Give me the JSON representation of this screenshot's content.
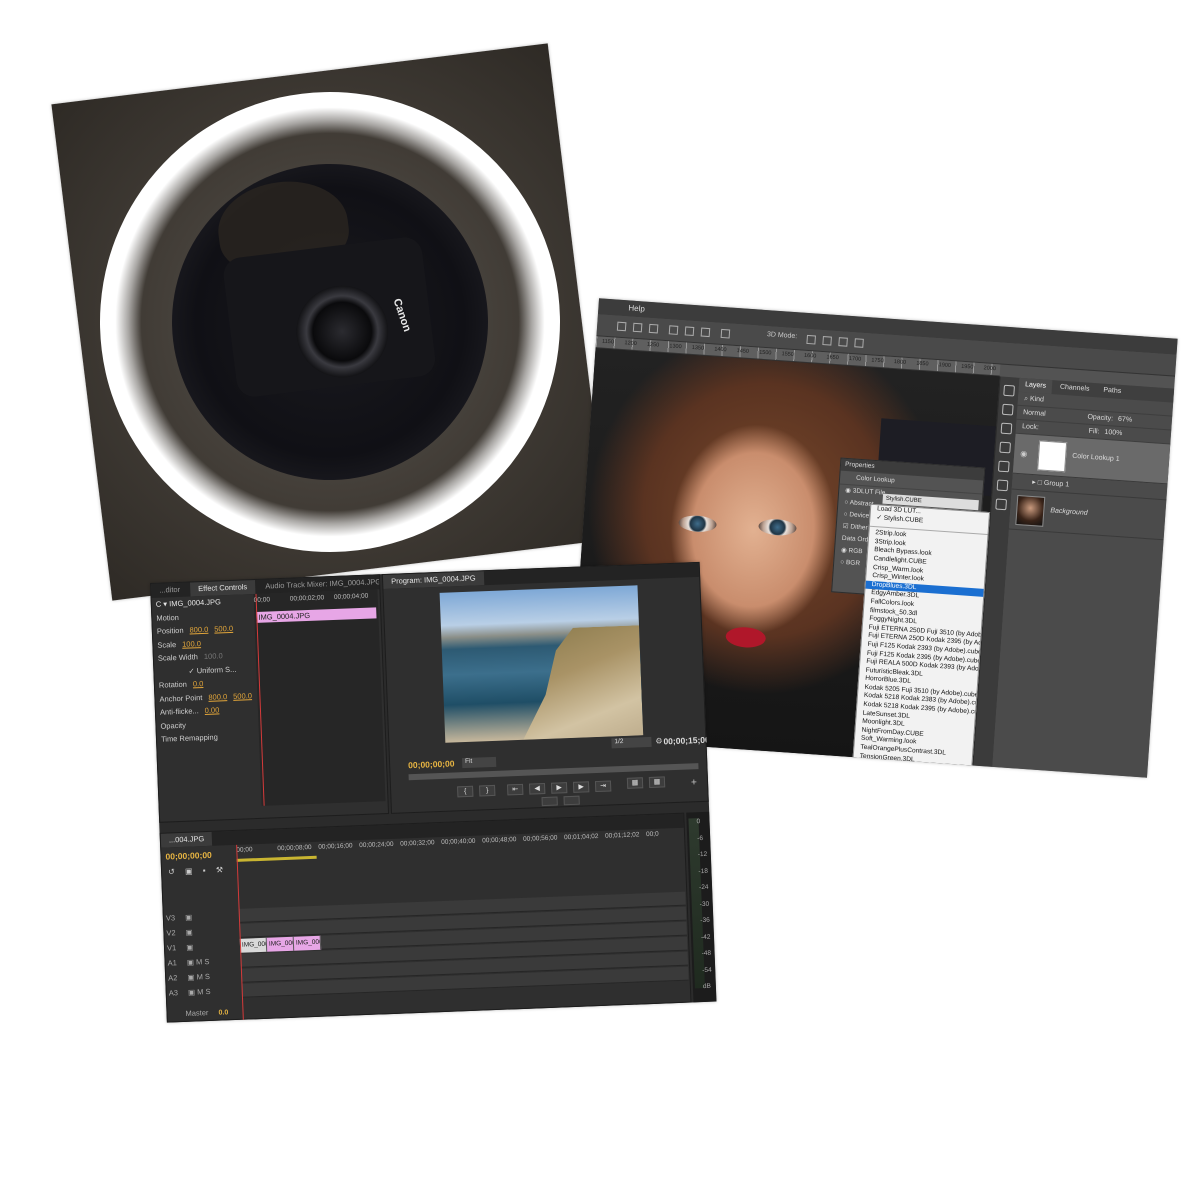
{
  "ring_photo": {
    "camera_brand": "Canon"
  },
  "photoshop": {
    "menu": "Help",
    "ruler_ticks": [
      "1150",
      "1200",
      "1250",
      "1300",
      "1350",
      "1400",
      "1450",
      "1500",
      "1550",
      "1600",
      "1650",
      "1700",
      "1750",
      "1800",
      "1850",
      "1900",
      "1950",
      "2000"
    ],
    "toolbar_zoom_label": "3D Mode:",
    "layers_panel": {
      "tabs": [
        "Layers",
        "Channels",
        "Paths"
      ],
      "kind": "Kind",
      "blend_mode": "Normal",
      "opacity_label": "Opacity:",
      "opacity_value": "67%",
      "lock_label": "Lock:",
      "fill_label": "Fill:",
      "fill_value": "100%",
      "layers": [
        {
          "name": "Color Lookup 1",
          "type": "adjustment"
        },
        {
          "name": "Group 1",
          "type": "group"
        },
        {
          "name": "Background",
          "type": "photo"
        }
      ]
    },
    "properties_panel": {
      "title": "Properties",
      "subtitle": "Color Lookup",
      "options": [
        "3DLUT File",
        "Abstract",
        "Device Link",
        "Dither",
        "Data Order",
        "RGB",
        "BGR"
      ],
      "selected_lut": "Stylish.CUBE"
    },
    "lut_menu": {
      "header": [
        "Load 3D LUT...",
        "Stylish.CUBE"
      ],
      "checked": "Stylish.CUBE",
      "items": [
        "2Strip.look",
        "3Strip.look",
        "Bleach Bypass.look",
        "Candlelight.CUBE",
        "Crisp_Warm.look",
        "Crisp_Winter.look",
        "DropBlues.3DL",
        "EdgyAmber.3DL",
        "FallColors.look",
        "filmstock_50.3dl",
        "FoggyNight.3DL",
        "Fuji ETERNA 250D Fuji 3510 (by Adobe).cube",
        "Fuji ETERNA 250D Kodak 2395 (by Adobe).cube",
        "Fuji F125 Kodak 2393 (by Adobe).cube",
        "Fuji F125 Kodak 2395 (by Adobe).cube",
        "Fuji REALA 500D Kodak 2393 (by Adobe).cube",
        "FuturisticBleak.3DL",
        "HorrorBlue.3DL",
        "Kodak 5205 Fuji 3510 (by Adobe).cube",
        "Kodak 5218 Kodak 2383 (by Adobe).cube",
        "Kodak 5218 Kodak 2395 (by Adobe).cube",
        "LateSunset.3DL",
        "Moonlight.3DL",
        "NightFromDay.CUBE",
        "Soft_Warming.look",
        "TealOrangePlusContrast.3DL",
        "TensionGreen.3DL"
      ],
      "highlighted": "DropBlues.3DL"
    }
  },
  "premiere": {
    "panel_tabs": [
      "...ditor",
      "Effect Controls",
      "Audio Track Mixer: IMG_0004.JPG"
    ],
    "active_tab": "Effect Controls",
    "effect_controls": {
      "clip_name": "IMG_0004.JPG",
      "clip_prefix": "C",
      "timecodes": [
        "00;00",
        "00;00;02;00",
        "00;00;04;00"
      ],
      "mini_clip": "IMG_0004.JPG",
      "rows": [
        {
          "label": "Motion",
          "values": []
        },
        {
          "label": "Position",
          "values": [
            "800.0",
            "500.0"
          ]
        },
        {
          "label": "Scale",
          "values": [
            "100.0"
          ]
        },
        {
          "label": "Scale Width",
          "values": [
            "100.0"
          ],
          "dim": true
        },
        {
          "label": "Uniform S...",
          "values": [],
          "checkbox": true
        },
        {
          "label": "Rotation",
          "values": [
            "0.0"
          ]
        },
        {
          "label": "Anchor Point",
          "values": [
            "800.0",
            "500.0"
          ]
        },
        {
          "label": "Anti-flicke...",
          "values": [
            "0.00"
          ]
        },
        {
          "label": "Opacity",
          "values": []
        },
        {
          "label": "Time Remapping",
          "values": []
        }
      ]
    },
    "program_monitor": {
      "title": "Program: IMG_0004.JPG",
      "timecode_in": "00;00;00;00",
      "timecode_out": "00;00;15;00",
      "fit": "Fit",
      "resolution": "1/2"
    },
    "timeline": {
      "sequence_tab": "...004.JPG",
      "timecode": "00;00;00;00",
      "ruler": [
        "00;00",
        "00;00;08;00",
        "00;00;16;00",
        "00;00;24;00",
        "00;00;32;00",
        "00;00;40;00",
        "00;00;48;00",
        "00;00;56;00",
        "00;01;04;02",
        "00;01;12;02",
        "00;0"
      ],
      "video_tracks": [
        "V3",
        "V2",
        "V1"
      ],
      "audio_tracks": [
        "A1",
        "A2",
        "A3"
      ],
      "master_label": "Master",
      "master_value": "0.0",
      "clips": [
        {
          "track": "V1",
          "name": "IMG_000",
          "color": "#d9d9d9"
        },
        {
          "track": "V1",
          "name": "IMG_000",
          "color": "#e7a6e6"
        },
        {
          "track": "V1",
          "name": "IMG_000",
          "color": "#e7a6e6"
        }
      ],
      "meter_scale": [
        "0",
        "-6",
        "-12",
        "-18",
        "-24",
        "-30",
        "-36",
        "-42",
        "-48",
        "-54",
        "dB"
      ],
      "meter_suffix": "dB"
    }
  }
}
